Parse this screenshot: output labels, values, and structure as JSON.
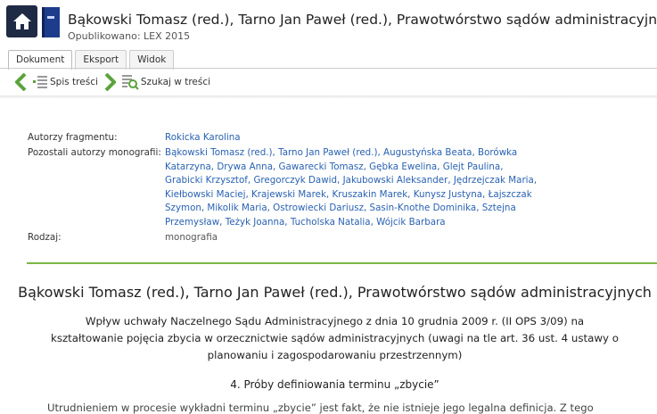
{
  "header": {
    "title": "Bąkowski Tomasz (red.), Tarno Jan Paweł (red.), Prawotwórstwo sądów administracyjnych",
    "published": "Opublikowano: LEX 2015"
  },
  "tabs": [
    "Dokument",
    "Eksport",
    "Widok"
  ],
  "toolbar": {
    "toc_label": "Spis treści",
    "search_label": "Szukaj w treści"
  },
  "meta": {
    "fragment_authors_label": "Autorzy fragmentu:",
    "fragment_authors": "Rokicka Karolina",
    "other_authors_label": "Pozostali autorzy monografii:",
    "other_authors": "Bąkowski Tomasz (red.), Tarno Jan Paweł (red.), Augustyńska Beata, Borówka Katarzyna, Drywa Anna, Gawarecki Tomasz, Gębka Ewelina, Glejt Paulina, Grabicki Krzysztof, Gregorczyk Dawid, Jakubowski Aleksander, Jędrzejczak Maria, Kiełbowski Maciej, Krajewski Marek, Kruszakin Marek, Kunysz Justyna, Łajszczak Szymon, Mikolik Maria, Ostrowiecki Dariusz, Sasin-Knothe Dominika, Sztejna Przemysław, Teżyk Joanna, Tucholska Natalia, Wójcik Barbara",
    "type_label": "Rodzaj:",
    "type_value": "monografia"
  },
  "document": {
    "title": "Bąkowski Tomasz (red.), Tarno Jan Paweł (red.), Prawotwórstwo sądów administracyjnych",
    "subtitle": "Wpływ uchwały Naczelnego Sądu Administracyjnego z dnia 10 grudnia 2009 r. (II OPS 3/09) na kształtowanie pojęcia zbycia w orzecznictwie sądów administracyjnych (uwagi na tle art. 36 ust. 4 ustawy o planowaniu i zagospodarowaniu przestrzennym)",
    "section": "4. Próby definiowania terminu „zbycie”",
    "paragraph": "Utrudnieniem w procesie wykładni terminu „zbycie” jest fakt, że nie istnieje jego legalna definicja. Z tego"
  },
  "colors": {
    "link": "#2a62b2",
    "accent_green": "#7ab648",
    "nav_green": "#5ba33b",
    "home_bg": "#1f2a44"
  },
  "icons": [
    "home-icon",
    "book-icon",
    "arrow-left-icon",
    "toc-icon",
    "arrow-right-icon",
    "search-document-icon"
  ]
}
